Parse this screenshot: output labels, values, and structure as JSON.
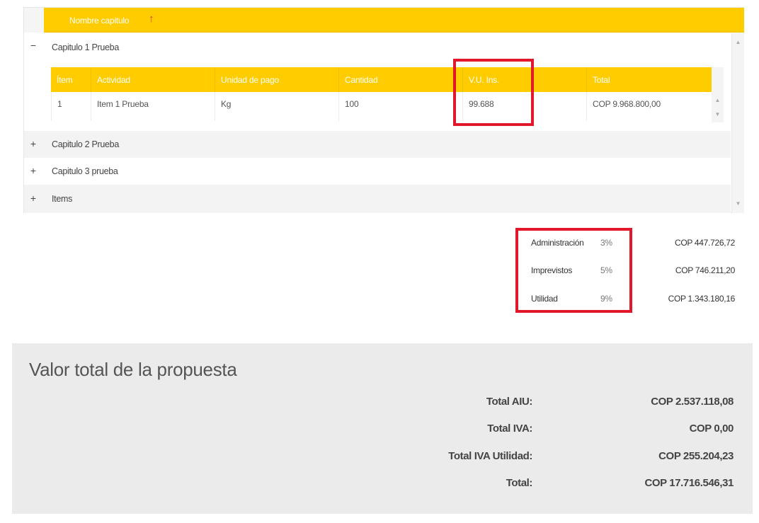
{
  "grid": {
    "header_label": "Nombre capitulo",
    "sort_icon": "arrow-up-icon",
    "chapters": [
      {
        "toggle": "−",
        "label": "Capitulo 1 Prueba"
      },
      {
        "toggle": "+",
        "label": "Capitulo 2 Prueba"
      },
      {
        "toggle": "+",
        "label": "Capitulo 3 prueba"
      },
      {
        "toggle": "+",
        "label": "Items"
      }
    ],
    "detail": {
      "columns": [
        "Ítem",
        "Actividad",
        "Unidad de pago",
        "Cantidad",
        "V.U. Ins.",
        "Total"
      ],
      "rows": [
        {
          "item": "1",
          "actividad": "Item 1 Prueba",
          "unidad": "Kg",
          "cantidad": "100",
          "vu": "99.688",
          "total": "COP 9.968.800,00"
        }
      ]
    }
  },
  "aiu": {
    "rows": [
      {
        "label": "Administración",
        "pct": "3%",
        "value": "COP 447.726,72"
      },
      {
        "label": "Imprevistos",
        "pct": "5%",
        "value": "COP 746.211,20"
      },
      {
        "label": "Utilidad",
        "pct": "9%",
        "value": "COP 1.343.180,16"
      }
    ]
  },
  "totals": {
    "title": "Valor total de la propuesta",
    "rows": [
      {
        "label": "Total AIU:",
        "value": "COP 2.537.118,08"
      },
      {
        "label": "Total IVA:",
        "value": "COP 0,00"
      },
      {
        "label": "Total IVA Utilidad:",
        "value": "COP 255.204,23"
      },
      {
        "label": "Total:",
        "value": "COP 17.716.546,31"
      }
    ]
  },
  "colors": {
    "header": "#ffcc00",
    "highlight": "#e3172b",
    "panel": "#ebebeb"
  }
}
